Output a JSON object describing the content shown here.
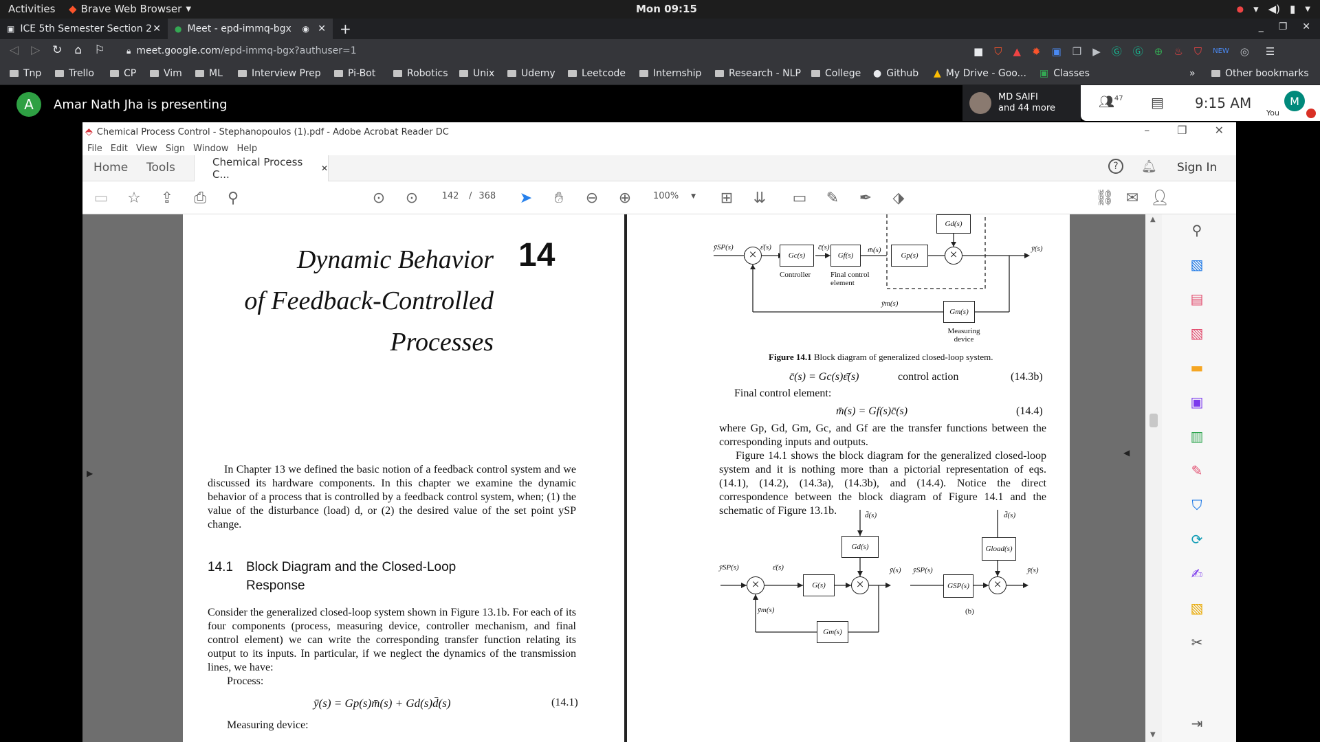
{
  "system": {
    "activities": "Activities",
    "app_name": "Brave Web Browser",
    "clock": "Mon 09:15"
  },
  "browser": {
    "tabs": [
      {
        "label": "ICE 5th Semester Section 2"
      },
      {
        "label": "Meet - epd-immq-bgx"
      }
    ],
    "url_host": "meet.google.com",
    "url_path": "/epd-immq-bgx?authuser=1",
    "bookmarks": [
      "Tnp",
      "Trello",
      "CP",
      "Vim",
      "ML",
      "Interview Prep",
      "Pi-Bot",
      "Robotics",
      "Unix",
      "Udemy",
      "Leetcode",
      "Internship",
      "Research - NLP",
      "College",
      "Github",
      "My Drive - Goo...",
      "Classes"
    ],
    "other_bookmarks": "Other bookmarks"
  },
  "meet": {
    "presenter_initial": "A",
    "presenter_text": "Amar Nath Jha is presenting",
    "participant_name": "MD SAIFI",
    "participant_more": "and 44 more",
    "people_count": "47",
    "time": "9:15 AM",
    "you_initial": "M",
    "you_label": "You"
  },
  "acrobat": {
    "title": "Chemical Process Control - Stephanopoulos (1).pdf - Adobe Acrobat Reader DC",
    "menu": [
      "File",
      "Edit",
      "View",
      "Sign",
      "Window",
      "Help"
    ],
    "nav": {
      "home": "Home",
      "tools": "Tools",
      "doc_tab": "Chemical Process C...",
      "sign_in": "Sign In"
    },
    "page_current": "142",
    "page_sep": "/",
    "page_total": "368",
    "zoom": "100%"
  },
  "left_page": {
    "chapter_title_1": "Dynamic Behavior",
    "chapter_title_2": "of Feedback-Controlled",
    "chapter_title_3": "Processes",
    "chapter_num": "14",
    "intro": "In Chapter 13 we defined the basic notion of a feedback control system and we discussed its hardware components. In this chapter we examine the dynamic behavior of a process that is controlled by a feedback control system, when; (1) the value of the disturbance (load) d, or (2) the desired value of the set point ySP change.",
    "section_num": "14.1",
    "section_title": "Block Diagram and the Closed-Loop Response",
    "para": "Consider the generalized closed-loop system shown in Figure 13.1b. For each of its four components (process, measuring device, controller mechanism, and final control element) we can write the corresponding transfer function relating its output to its inputs. In particular, if we neglect the dynamics of the transmission lines, we have:",
    "process_label": "Process:",
    "eq1": "ȳ(s) = Gp(s)m̄(s) + Gd(s)d̄(s)",
    "eq1_num": "(14.1)",
    "measuring_label": "Measuring device:"
  },
  "right_page": {
    "fig_caption_bold": "Figure 14.1",
    "fig_caption": "Block diagram of generalized closed-loop system.",
    "eq_c": "c̄(s) = Gc(s)ε̄(s)",
    "eq_c_label": "control action",
    "eq_c_num": "(14.3b)",
    "final_label": "Final control element:",
    "eq_m": "m̄(s) = Gf(s)c̄(s)",
    "eq_m_num": "(14.4)",
    "para1": "where Gp, Gd, Gm, Gc, and Gf are the transfer functions between the corresponding inputs and outputs.",
    "para2": "Figure 14.1 shows the block diagram for the generalized closed-loop system and it is nothing more than a pictorial representation of eqs. (14.1), (14.2), (14.3a), (14.3b), and (14.4). Notice the direct correspondence between the block diagram of Figure 14.1 and the schematic of Figure 13.1b.",
    "diagram": {
      "gc": "Gc(s)",
      "gf": "Gf(s)",
      "gp": "Gp(s)",
      "gd": "Gd(s)",
      "gm": "Gm(s)",
      "controller": "Controller",
      "final_control": "Final control element",
      "measuring": "Measuring device",
      "ysp": "ȳSP(s)",
      "eps": "ε̄(s)",
      "cbar": "c̄(s)",
      "mbar": "m̄(s)",
      "ybar": "ȳ(s)",
      "ym": "ȳm(s)",
      "dbar": "d̄(s)",
      "g": "G(s)",
      "gload": "Gload(s)",
      "gsp": "GSP(s)",
      "b_label": "(b)"
    }
  },
  "colors": {
    "accent_green": "#2ea043",
    "brave_orange": "#fb542b",
    "acrobat_red": "#d7373f"
  }
}
